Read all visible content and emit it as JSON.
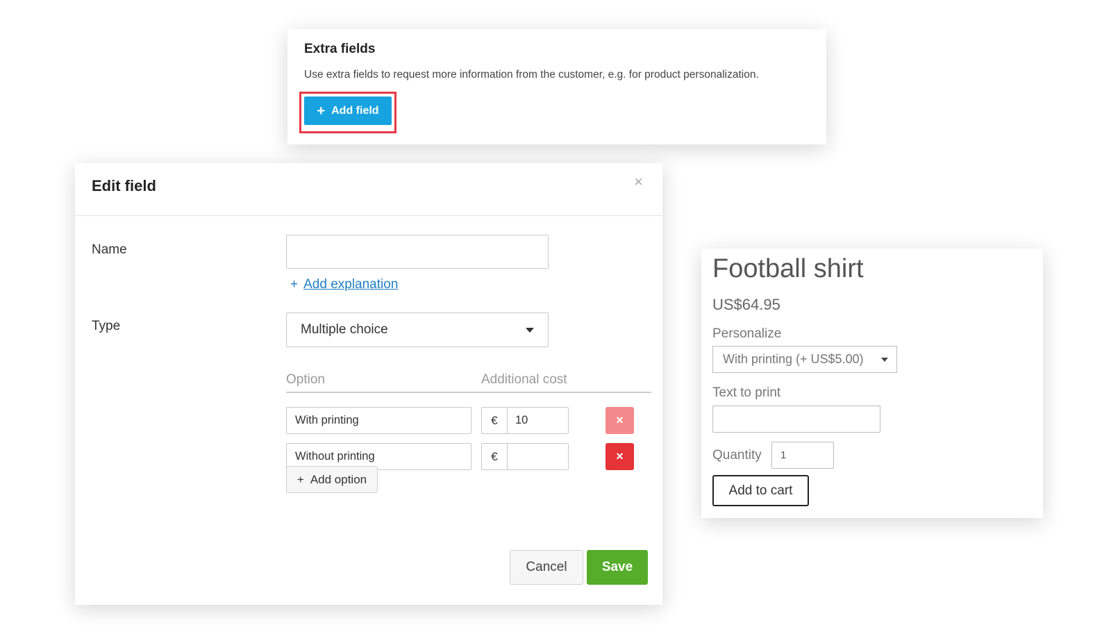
{
  "extra_fields": {
    "title": "Extra fields",
    "description": "Use extra fields to request more information from the customer, e.g. for product personalization.",
    "add_field_label": "Add field",
    "add_field_icon": "plus-icon",
    "highlight_color": "#e53945",
    "button_color": "#17a3e0"
  },
  "edit_field": {
    "title": "Edit field",
    "close_glyph": "×",
    "name_label": "Name",
    "name_value": "",
    "add_explanation_label": "Add explanation",
    "type_label": "Type",
    "type_value": "Multiple choice",
    "options_header": {
      "option": "Option",
      "additional_cost": "Additional cost"
    },
    "options": [
      {
        "name": "With printing",
        "currency": "€",
        "cost": "10",
        "remove_glyph": "×"
      },
      {
        "name": "Without printing",
        "currency": "€",
        "cost": "",
        "remove_glyph": "×"
      }
    ],
    "add_option_label": "Add option",
    "cancel_label": "Cancel",
    "save_label": "Save",
    "save_color": "#55ad2a",
    "remove_color": "#e53338"
  },
  "product": {
    "title": "Football shirt",
    "price": "US$64.95",
    "personalize_label": "Personalize",
    "personalize_value": "With printing (+ US$5.00)",
    "text_to_print_label": "Text to print",
    "text_to_print_value": "",
    "quantity_label": "Quantity",
    "quantity_value": "1",
    "add_to_cart_label": "Add to cart"
  }
}
